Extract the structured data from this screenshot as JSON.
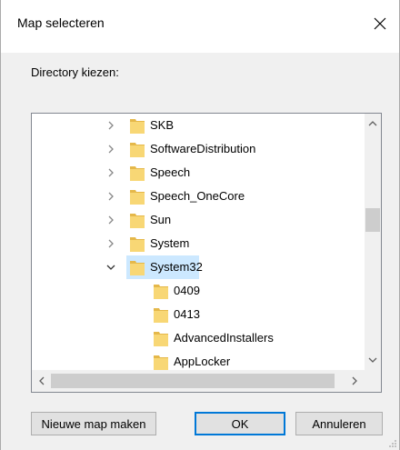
{
  "dialog": {
    "title": "Map selecteren",
    "prompt": "Directory kiezen:"
  },
  "icons": {
    "close": "close-icon",
    "expand": "chevron-right-icon",
    "collapse": "chevron-down-icon",
    "folder": "folder-icon"
  },
  "tree": {
    "items": [
      {
        "label": "SKB",
        "level": 1,
        "state": "collapsed",
        "selected": false
      },
      {
        "label": "SoftwareDistribution",
        "level": 1,
        "state": "collapsed",
        "selected": false
      },
      {
        "label": "Speech",
        "level": 1,
        "state": "collapsed",
        "selected": false
      },
      {
        "label": "Speech_OneCore",
        "level": 1,
        "state": "collapsed",
        "selected": false
      },
      {
        "label": "Sun",
        "level": 1,
        "state": "collapsed",
        "selected": false
      },
      {
        "label": "System",
        "level": 1,
        "state": "collapsed",
        "selected": false
      },
      {
        "label": "System32",
        "level": 1,
        "state": "expanded",
        "selected": true
      },
      {
        "label": "0409",
        "level": 2,
        "state": "leaf",
        "selected": false
      },
      {
        "label": "0413",
        "level": 2,
        "state": "leaf",
        "selected": false
      },
      {
        "label": "AdvancedInstallers",
        "level": 2,
        "state": "leaf",
        "selected": false
      },
      {
        "label": "AppLocker",
        "level": 2,
        "state": "leaf",
        "selected": false
      }
    ]
  },
  "buttons": {
    "new_folder": "Nieuwe map maken",
    "ok": "OK",
    "cancel": "Annuleren"
  },
  "colors": {
    "folder": "#f8d775",
    "folder_dark": "#e5b84a",
    "selection": "#cce8ff",
    "accent": "#0078d7"
  }
}
